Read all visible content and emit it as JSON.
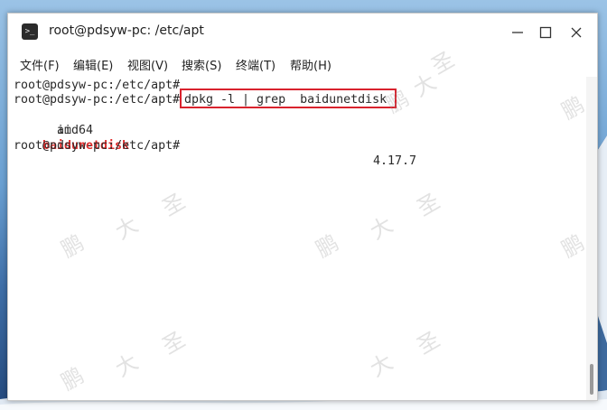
{
  "window": {
    "title": "root@pdsyw-pc: /etc/apt",
    "app_icon_glyph": ">_"
  },
  "menu": [
    {
      "label": "文件(F)"
    },
    {
      "label": "编辑(E)"
    },
    {
      "label": "视图(V)"
    },
    {
      "label": "搜索(S)"
    },
    {
      "label": "终端(T)"
    },
    {
      "label": "帮助(H)"
    }
  ],
  "terminal": {
    "prompt1": "root@pdsyw-pc:/etc/apt#",
    "prompt2": "root@pdsyw-pc:/etc/apt#",
    "command": "dpkg -l | grep  baidunetdisk",
    "result_status": "ii",
    "result_package": "baidunetdisk",
    "result_version": "4.17.7",
    "result_arch": "      amd64",
    "prompt3": "root@pdsyw-pc:/etc/apt#"
  },
  "watermark": {
    "chars": [
      "鹏",
      "大",
      "圣"
    ]
  },
  "colors": {
    "highlight_box": "#d9232e",
    "package_name": "#e02b2b",
    "terminal_bg": "#ffffff"
  }
}
